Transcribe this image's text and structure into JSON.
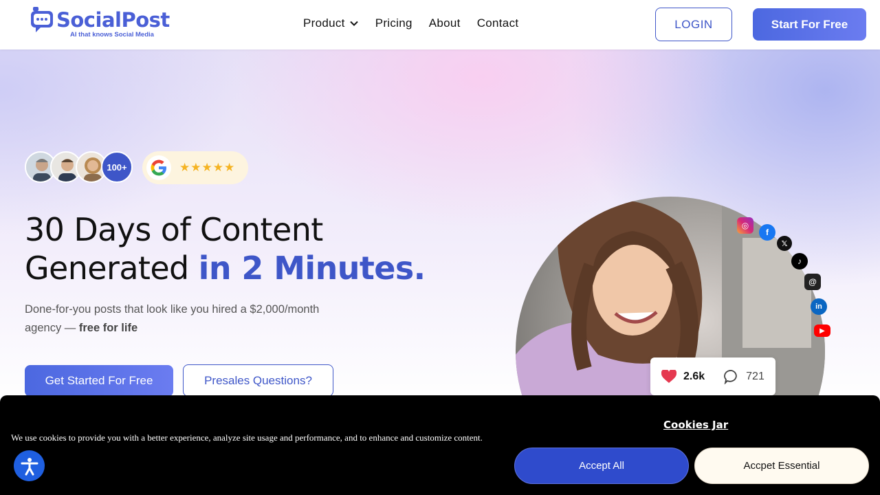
{
  "brand": {
    "name": "SocialPost",
    "tagline": "AI that knows Social Media",
    "color": "#4a5fd6"
  },
  "nav": {
    "items": [
      {
        "label": "Product",
        "has_dropdown": true
      },
      {
        "label": "Pricing"
      },
      {
        "label": "About"
      },
      {
        "label": "Contact"
      }
    ],
    "login_label": "LOGIN",
    "start_label": "Start For Free"
  },
  "hero": {
    "avatar_count": "100+",
    "rating_stars": "★★★★★",
    "title_line1": "30 Days of Content",
    "title_line2_plain": "Generated ",
    "title_line2_accent": "in 2 Minutes.",
    "subtitle_plain": "Done-for-you posts that look like you hired a $2,000/month agency — ",
    "subtitle_bold": "free for life",
    "cta_primary": "Get Started For Free",
    "cta_secondary": "Presales Questions?",
    "accent_color": "#3e56c8"
  },
  "visual": {
    "social_icons": [
      "instagram-icon",
      "facebook-icon",
      "x-icon",
      "tiktok-icon",
      "threads-icon",
      "linkedin-icon",
      "youtube-icon"
    ],
    "likes": "2.6k",
    "comments": "721"
  },
  "cookie": {
    "title": "Cookies Jar",
    "text": "We use cookies to provide you with a better experience, analyze site usage and performance, and to enhance and customize content.",
    "accept_all": "Accept All",
    "accept_essential": "Accpet Essential"
  }
}
